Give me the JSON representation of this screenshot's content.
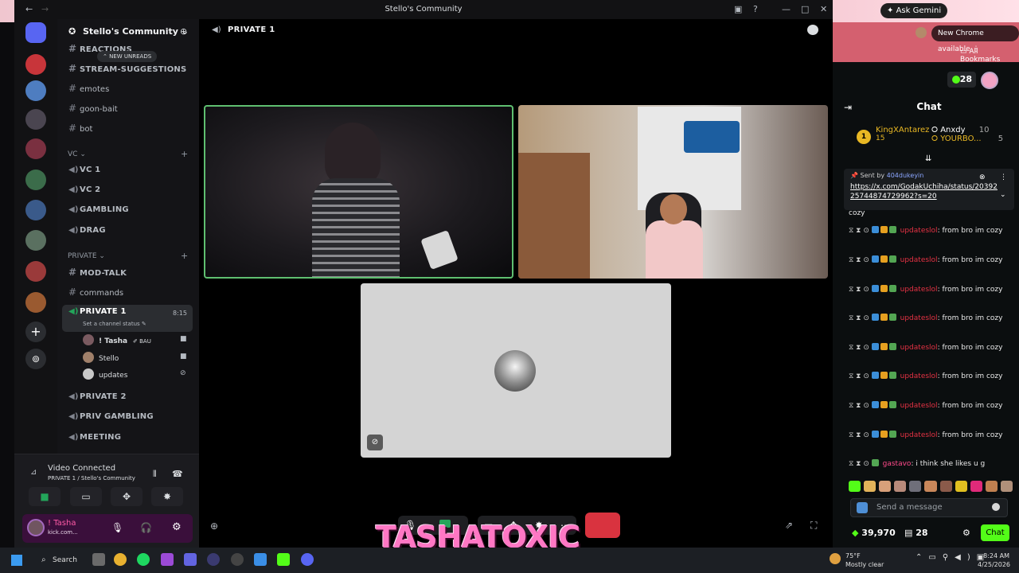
{
  "chrome": {
    "gemini_label": "Ask Gemini",
    "new_chrome_label": "New Chrome available",
    "all_bookmarks": "All Bookmarks"
  },
  "kick": {
    "viewer_count": "28",
    "chat_title": "Chat",
    "leaders": [
      {
        "name": "KingXAntarez",
        "score": "15"
      },
      {
        "name": "Anxdy",
        "score": "10"
      },
      {
        "name": "YOURBO...",
        "score": "5"
      }
    ],
    "pinned": {
      "sent_by_prefix": "Sent by",
      "sent_by_user": "404dukeyin",
      "link": "https://x.com/GodakUchiha/status/2039225744874729962?s=20",
      "overflow_text": "cozy"
    },
    "messages": [
      {
        "user": "updateslol",
        "text": ": from bro im cozy"
      },
      {
        "user": "updateslol",
        "text": ": from bro im cozy"
      },
      {
        "user": "updateslol",
        "text": ": from bro im cozy"
      },
      {
        "user": "updateslol",
        "text": ": from bro im cozy"
      },
      {
        "user": "updateslol",
        "text": ": from bro im cozy"
      },
      {
        "user": "updateslol",
        "text": ": from bro im cozy"
      },
      {
        "user": "updateslol",
        "text": ": from bro im cozy"
      },
      {
        "user": "updateslol",
        "text": ": from bro im cozy"
      }
    ],
    "last_message": {
      "user": "gastavo",
      "text": ": i think she likes u g"
    },
    "send_placeholder": "Send a message",
    "points": "39,970",
    "gifts": "28",
    "chat_button": "Chat"
  },
  "discord": {
    "window_title": "Stello's Community",
    "server_name": "Stello's Community",
    "new_unreads": "NEW UNREADS",
    "text_channels": [
      {
        "name": "REACTIONS"
      },
      {
        "name": "STREAM-SUGGESTIONS"
      },
      {
        "name": "emotes"
      },
      {
        "name": "goon-bait"
      },
      {
        "name": "bot"
      }
    ],
    "vc_category": "VC",
    "vc_channels": [
      "VC 1",
      "VC 2",
      "GAMBLING",
      "DRAG"
    ],
    "private_category": "PRIVATE",
    "private_channels": [
      "MOD-TALK",
      "commands"
    ],
    "active_channel": "PRIVATE 1",
    "active_time": "8:15",
    "status_placeholder": "Set a channel status",
    "vc_users": [
      {
        "name": "! Tasha",
        "tag": "BAU"
      },
      {
        "name": "Stello",
        "tag": ""
      },
      {
        "name": "updates",
        "tag": ""
      }
    ],
    "more_voice": [
      "PRIVATE 2",
      "PRIV GAMBLING",
      "MEETING"
    ],
    "voice_status": "Video Connected",
    "voice_location": "PRIVATE 1 / Stello's Community",
    "user_name": "! Tasha",
    "user_sub": "kick.com...",
    "main_title": "PRIVATE 1",
    "overlay_name": "TASHATOXIC"
  },
  "taskbar": {
    "search": "Search",
    "weather_temp": "75°F",
    "weather_desc": "Mostly clear",
    "time": "8:24 AM",
    "date": "4/25/2026"
  }
}
